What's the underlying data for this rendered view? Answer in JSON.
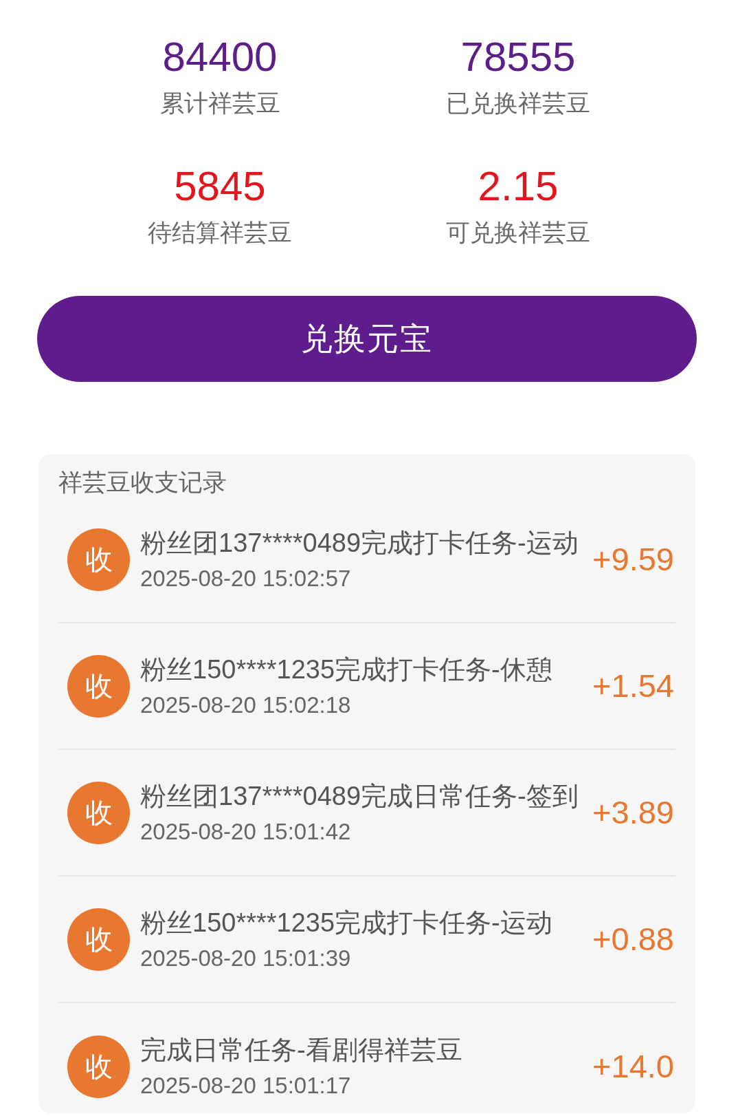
{
  "stats": [
    {
      "value": "84400",
      "label": "累计祥芸豆",
      "color": "#5c1f88"
    },
    {
      "value": "78555",
      "label": "已兑换祥芸豆",
      "color": "#5c1f88"
    },
    {
      "value": "5845",
      "label": "待结算祥芸豆",
      "color": "#e2161c"
    },
    {
      "value": "2.15",
      "label": "可兑换祥芸豆",
      "color": "#e2161c"
    }
  ],
  "exchange_button": {
    "label": "兑换元宝"
  },
  "records": {
    "title": "祥芸豆收支记录",
    "items": [
      {
        "badge": "收",
        "title": "粉丝团137****0489完成打卡任务-运动",
        "time": "2025-08-20 15:02:57",
        "amount": "+9.59"
      },
      {
        "badge": "收",
        "title": "粉丝150****1235完成打卡任务-休憩",
        "time": "2025-08-20 15:02:18",
        "amount": "+1.54"
      },
      {
        "badge": "收",
        "title": "粉丝团137****0489完成日常任务-签到",
        "time": "2025-08-20 15:01:42",
        "amount": "+3.89"
      },
      {
        "badge": "收",
        "title": "粉丝150****1235完成打卡任务-运动",
        "time": "2025-08-20 15:01:39",
        "amount": "+0.88"
      },
      {
        "badge": "收",
        "title": "完成日常任务-看剧得祥芸豆",
        "time": "2025-08-20 15:01:17",
        "amount": "+14.0"
      }
    ]
  }
}
